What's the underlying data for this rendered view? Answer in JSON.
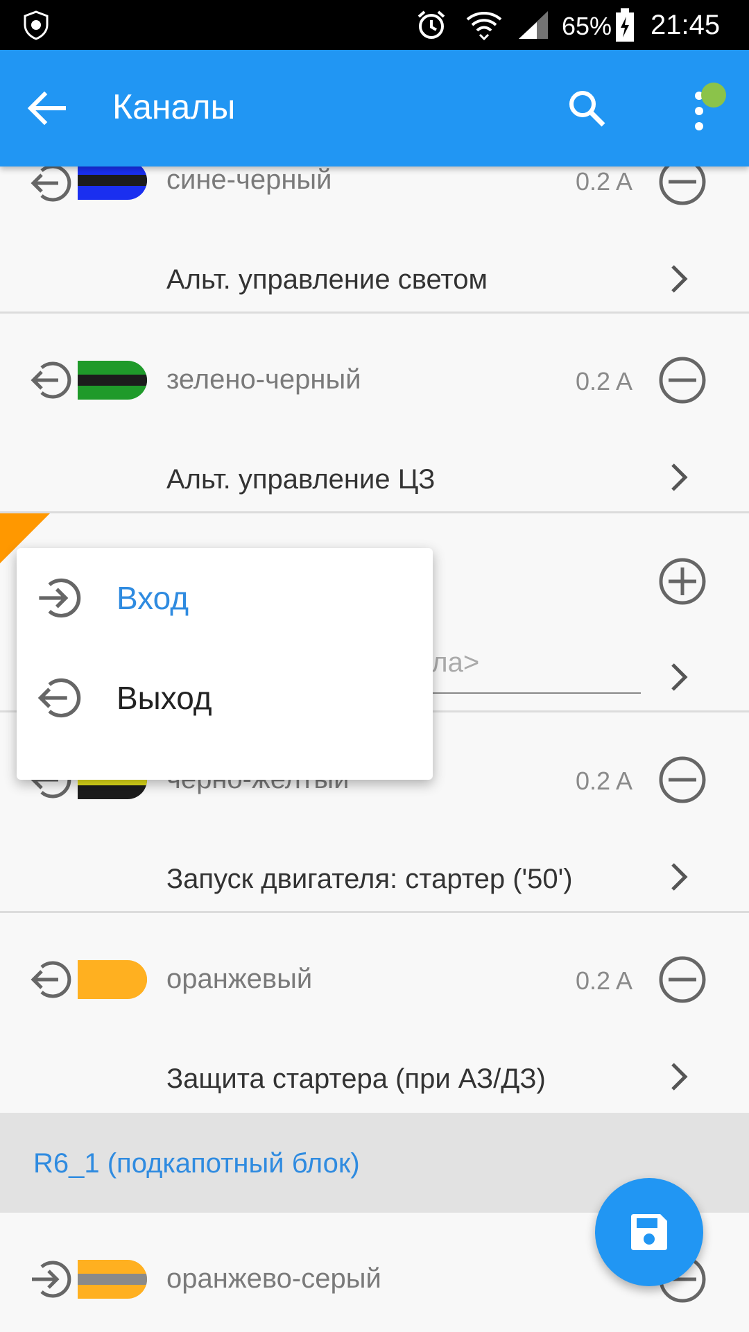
{
  "status_bar": {
    "battery_percent": "65%",
    "time": "21:45",
    "icons": [
      "shield-app-icon",
      "alarm-icon",
      "wifi-icon",
      "signal-icon",
      "battery-charging-icon"
    ]
  },
  "app_bar": {
    "title": "Каналы",
    "icons": [
      "back-arrow-icon",
      "search-icon",
      "overflow-menu-icon"
    ],
    "notification_dot_color": "#8bc34a"
  },
  "channels": [
    {
      "name": "сине-черный",
      "amperage": "0.2 A",
      "function": "Альт. управление светом",
      "direction": "output",
      "action": "remove",
      "wire_color": "#1a2ff0",
      "stripe_color": "#1c1c1c"
    },
    {
      "name": "зелено-черный",
      "amperage": "0.2 A",
      "function": "Альт. управление ЦЗ",
      "direction": "output",
      "action": "remove",
      "wire_color": "#1f9a2a",
      "stripe_color": "#1c1c1c"
    },
    {
      "name": "",
      "amperage": "",
      "function_placeholder": "ала>",
      "action": "add"
    },
    {
      "name": "черно-желтый",
      "amperage": "0.2 A",
      "function": "Запуск двигателя: стартер ('50')",
      "direction": "output",
      "action": "remove",
      "wire_color": "#1c1c1c",
      "stripe_color": "#e6e21a"
    },
    {
      "name": "оранжевый",
      "amperage": "0.2 A",
      "function": "Защита стартера (при АЗ/ДЗ)",
      "direction": "output",
      "action": "remove",
      "wire_color": "#ffb020",
      "stripe_color": "#ffb020"
    }
  ],
  "section": {
    "label": "R6_1 (подкапотный блок)"
  },
  "section_channels": [
    {
      "name": "оранжево-серый",
      "direction": "input",
      "action": "remove",
      "wire_color": "#ffb020",
      "stripe_color": "#8a8a8a"
    }
  ],
  "popup_menu": {
    "items": [
      {
        "label": "Вход",
        "icon": "input-arrow-icon",
        "selected": true,
        "color": "#2f8be0"
      },
      {
        "label": "Выход",
        "icon": "output-arrow-icon",
        "selected": false,
        "color": "#222222"
      }
    ]
  },
  "fab": {
    "icon": "save-icon",
    "color": "#2196f3"
  }
}
